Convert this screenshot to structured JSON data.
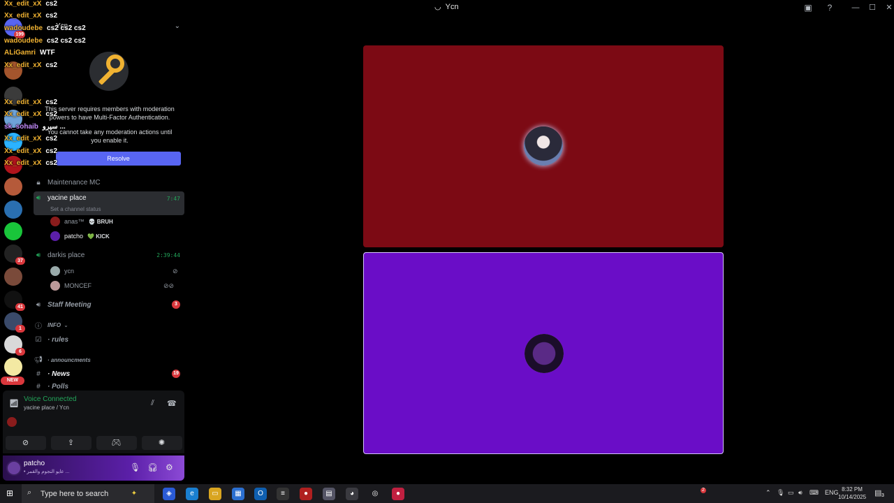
{
  "window": {
    "title": "Ycn"
  },
  "overlay_chat": [
    {
      "name": "Xx_edit_xX",
      "msg": "cs2"
    },
    {
      "name": "Xx_edit_xX",
      "msg": "cs2"
    },
    {
      "name": "wadoudebe",
      "msg": "cs2 cs2 cs2"
    },
    {
      "name": "wadoudebe",
      "msg": "cs2 cs2 cs2"
    },
    {
      "name": "ALiGamri",
      "msg": "WTF"
    },
    {
      "name": "Xx_edit_xX",
      "msg": "cs2"
    },
    {
      "name": "Xx_edit_xX",
      "msg": "cs2"
    },
    {
      "name": "Xx_edit_xX",
      "msg": "cs2"
    },
    {
      "name": "sk_sohaib",
      "msg": "سيرو ..."
    },
    {
      "name": "Xx_edit_xX",
      "msg": "cs2"
    },
    {
      "name": "Xx_edit_xX",
      "msg": "cs2"
    },
    {
      "name": "Xx_edit_xX",
      "msg": "cs2"
    }
  ],
  "rail_badges": [
    "199",
    "37",
    "41",
    "1",
    "6"
  ],
  "rail_new": "NEW",
  "server": {
    "name": "Ycn",
    "mfa_line1": "This server requires members with moderation powers to have Multi-Factor Authentication.",
    "mfa_line2": "You cannot take any moderation actions until you enable it.",
    "resolve_label": "Resolve"
  },
  "channels": {
    "maintenance": "Maintenance MC",
    "yacine_place": "yacine place",
    "yacine_time": "7:47",
    "set_status": "Set a channel status",
    "members_yacine": [
      {
        "name": "anas™",
        "tag": "💀 BRUH"
      },
      {
        "name": "patcho",
        "tag": "💚 KICK"
      }
    ],
    "darkis_place": "darkis place",
    "darkis_time": "2:39:44",
    "members_darkis": [
      {
        "name": "ycn"
      },
      {
        "name": "MONCEF"
      }
    ],
    "staff_meeting": "Staff Meeting",
    "staff_badge": "3",
    "info_cat": "INFO",
    "rules": "· rules",
    "announcements_cat": "· announcments",
    "news": "· News",
    "news_badge": "19",
    "polls": "· Polls"
  },
  "voice": {
    "status": "Voice Connected",
    "location": "yacine place / Ycn"
  },
  "user": {
    "name": "patcho",
    "status": "• عايو النجوم والقمر ..."
  },
  "taskbar": {
    "search_placeholder": "Type here to search",
    "lang": "ENG",
    "time": "8:32 PM",
    "date": "10/14/2025",
    "notif_count": "3",
    "discord_badge": "2"
  }
}
